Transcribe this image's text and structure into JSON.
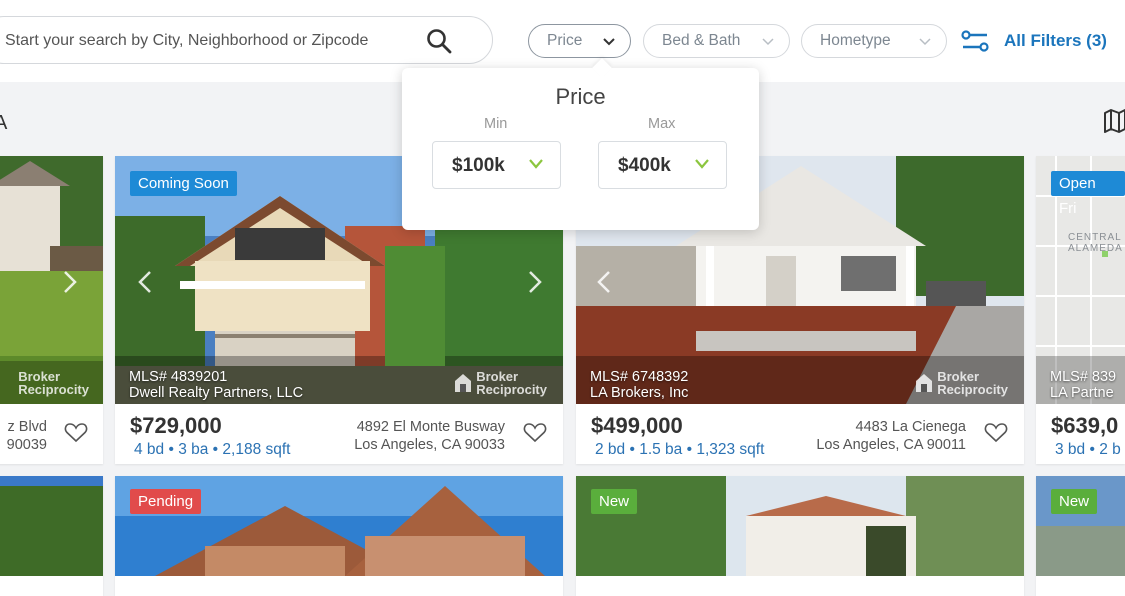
{
  "search": {
    "placeholder": "Start your search by City, Neighborhood or Zipcode",
    "icon": "search-icon"
  },
  "filters": {
    "price_label": "Price",
    "bed_bath_label": "Bed & Bath",
    "hometype_label": "Hometype",
    "all_filters_label": "All Filters (3)"
  },
  "header_partial_letter": "A",
  "price_popover": {
    "title": "Price",
    "min_caption": "Min",
    "max_caption": "Max",
    "min_value": "$100k",
    "max_value": "$400k"
  },
  "colors": {
    "brand_blue": "#1b75bc",
    "spec_blue": "#2b72b3",
    "badge_blue": "#1e8ad6",
    "badge_red": "#e14b4b",
    "badge_green": "#5aae3c",
    "chev_green": "#8cc63f"
  },
  "broker_text": "Broker Reciprocity",
  "listings": [
    {
      "mls": "",
      "office": "",
      "price": "",
      "specs": "",
      "addr1": "z Blvd",
      "addr2": "90039",
      "badge": ""
    },
    {
      "mls": "MLS# 4839201",
      "office": "Dwell Realty Partners, LLC",
      "price": "$729,000",
      "specs": "4 bd • 3 ba • 2,188 sqft",
      "addr1": "4892 El Monte Busway",
      "addr2": "Los Angeles, CA 90033",
      "badge": "Coming Soon"
    },
    {
      "mls": "MLS# 6748392",
      "office": "LA Brokers, Inc",
      "price": "$499,000",
      "specs": "2 bd • 1.5 ba • 1,323 sqft",
      "addr1": "4483 La Cienega",
      "addr2": "Los Angeles, CA 90011",
      "badge": ""
    },
    {
      "mls": "MLS# 839",
      "office": "LA Partne",
      "price": "$639,0",
      "specs": "3 bd • 2 b",
      "addr1": "",
      "addr2": "",
      "badge": "Open Fri"
    }
  ],
  "second_row_badges": [
    "Pending",
    "New",
    "New"
  ],
  "map_labels": [
    "CENTRAL",
    "ALAMEDA"
  ]
}
